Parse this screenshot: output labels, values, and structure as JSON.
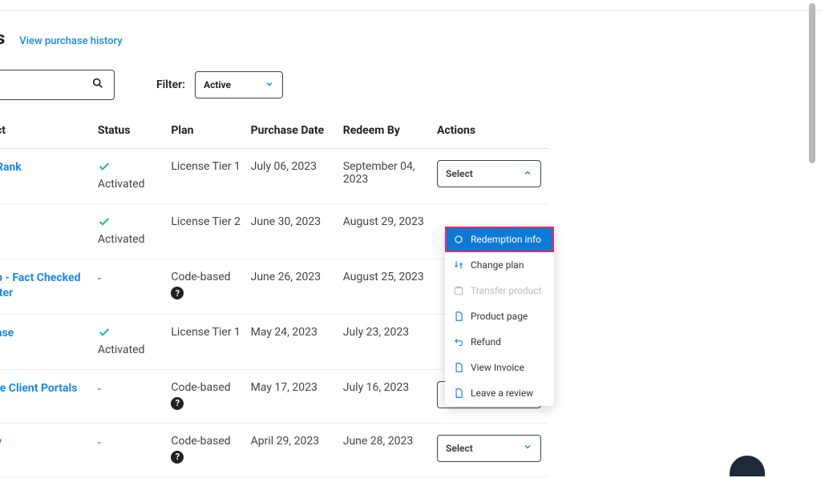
{
  "header": {
    "title_fragment": "s",
    "history_link": "View purchase history"
  },
  "filter": {
    "label": "Filter:",
    "selected": "Active"
  },
  "table": {
    "columns": {
      "product": "ct",
      "status": "Status",
      "plan": "Plan",
      "purchase": "Purchase Date",
      "redeem": "Redeem By",
      "actions": "Actions"
    },
    "rows": [
      {
        "product_link": "Rank",
        "status": "Activated",
        "has_check": true,
        "plan": "License Tier 1",
        "has_help": false,
        "purchase": "July 06, 2023",
        "redeem": "September 04, 2023",
        "select_open": true
      },
      {
        "product_link": "",
        "status": "Activated",
        "has_check": true,
        "plan": "License Tier 2",
        "has_help": false,
        "purchase": "June 30, 2023",
        "redeem": "August 29, 2023",
        "select_open": false,
        "hide_select": true
      },
      {
        "product_link": "b - Fact Checked iter",
        "status": "-",
        "has_check": false,
        "plan": "Code-based",
        "has_help": true,
        "purchase": "June 26, 2023",
        "redeem": "August 25, 2023",
        "select_open": false,
        "hide_select": true
      },
      {
        "product_link": "ase",
        "status": "Activated",
        "has_check": true,
        "plan": "License Tier 1",
        "has_help": false,
        "purchase": "May 24, 2023",
        "redeem": "July 23, 2023",
        "select_open": false,
        "hide_select": true
      },
      {
        "product_link": "te Client Portals",
        "status": "-",
        "has_check": false,
        "plan": "Code-based",
        "has_help": true,
        "purchase": "May 17, 2023",
        "redeem": "July 16, 2023",
        "select_open": false
      },
      {
        "product_link": "y",
        "status": "-",
        "has_check": false,
        "plan": "Code-based",
        "has_help": true,
        "purchase": "April 29, 2023",
        "redeem": "June 28, 2023",
        "select_open": false
      }
    ]
  },
  "select_label": "Select",
  "dropdown": {
    "items": [
      {
        "label": "Redemption info",
        "icon": "redemption",
        "highlight": true
      },
      {
        "label": "Change plan",
        "icon": "change-plan"
      },
      {
        "label": "Transfer product",
        "icon": "transfer",
        "disabled": true
      },
      {
        "label": "Product page",
        "icon": "page"
      },
      {
        "label": "Refund",
        "icon": "refund"
      },
      {
        "label": "View Invoice",
        "icon": "invoice"
      },
      {
        "label": "Leave a review",
        "icon": "review"
      }
    ]
  }
}
